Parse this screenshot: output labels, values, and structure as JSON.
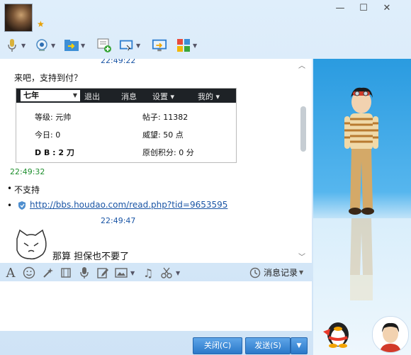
{
  "window": {
    "min": "—",
    "max": "☐",
    "close": "✕"
  },
  "toolbar": {
    "icons": [
      "mic-icon",
      "webcam-icon",
      "file-transfer-icon",
      "new-message-icon",
      "remote-assist-icon",
      "screen-share-icon",
      "apps-icon"
    ]
  },
  "chat": {
    "time1": "22:49:22",
    "msg1": "来吧，支持到付？",
    "card": {
      "user": "七年",
      "nav": [
        "退出",
        "消息",
        "设置 ▾",
        "我的 ▾"
      ],
      "rows": [
        [
          "等级: 元帅",
          "帖子: 11382"
        ],
        [
          "今日: 0",
          "威望: 50 点"
        ],
        [
          "D B : 2 刀",
          "原创积分: 0 分"
        ]
      ]
    },
    "time2": "22:49:32",
    "msg2": "不支持",
    "link": "http://bbs.houdao.com/read.php?tid=9653595",
    "time3": "22:49:47",
    "msg3": "那算 担保也不要了"
  },
  "bottom_toolbar": {
    "history": "消息记录"
  },
  "buttons": {
    "close": "关闭(C)",
    "send": "发送(S)"
  },
  "colors": {
    "accent": "#2a78c9",
    "time_blue": "#1a55a5",
    "time_green": "#1f8f2f",
    "link": "#1a55a5"
  }
}
